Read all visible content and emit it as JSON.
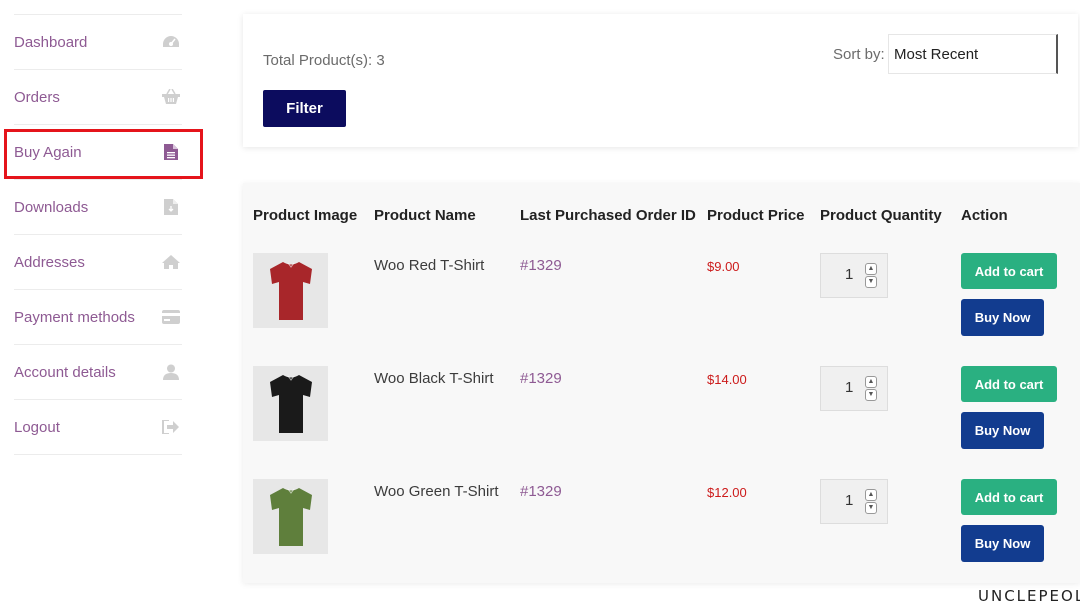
{
  "sidebar": {
    "items": [
      {
        "label": "Dashboard",
        "icon": "dashboard-icon"
      },
      {
        "label": "Orders",
        "icon": "basket-icon"
      },
      {
        "label": "Buy Again",
        "icon": "document-icon",
        "active": true
      },
      {
        "label": "Downloads",
        "icon": "file-download-icon"
      },
      {
        "label": "Addresses",
        "icon": "home-icon"
      },
      {
        "label": "Payment methods",
        "icon": "credit-card-icon"
      },
      {
        "label": "Account details",
        "icon": "user-icon"
      },
      {
        "label": "Logout",
        "icon": "sign-out-icon"
      }
    ]
  },
  "filter": {
    "total_label": "Total Product(s): 3",
    "filter_button": "Filter",
    "sort_label": "Sort by:",
    "sort_value": "Most Recent"
  },
  "table": {
    "headers": [
      "Product Image",
      "Product Name",
      "Last Purchased Order ID",
      "Product Price",
      "Product Quantity",
      "Action"
    ],
    "rows": [
      {
        "name": "Woo Red T-Shirt",
        "order": "#1329",
        "price": "$9.00",
        "qty": "1",
        "shirt_color": "#a8262a",
        "add_label": "Add to cart",
        "buy_label": "Buy Now"
      },
      {
        "name": "Woo Black T-Shirt",
        "order": "#1329",
        "price": "$14.00",
        "qty": "1",
        "shirt_color": "#1a1a1a",
        "add_label": "Add to cart",
        "buy_label": "Buy Now"
      },
      {
        "name": "Woo Green T-Shirt",
        "order": "#1329",
        "price": "$12.00",
        "qty": "1",
        "shirt_color": "#5f7f3c",
        "add_label": "Add to cart",
        "buy_label": "Buy Now"
      }
    ]
  },
  "colors": {
    "accent": "#8e5a93",
    "filter_button": "#0c0c5e",
    "add_to_cart": "#2ab081",
    "buy_now": "#123c8f",
    "price": "#cc1b1b",
    "highlight": "#e5141b"
  },
  "watermark": "UNCLEPEOL"
}
